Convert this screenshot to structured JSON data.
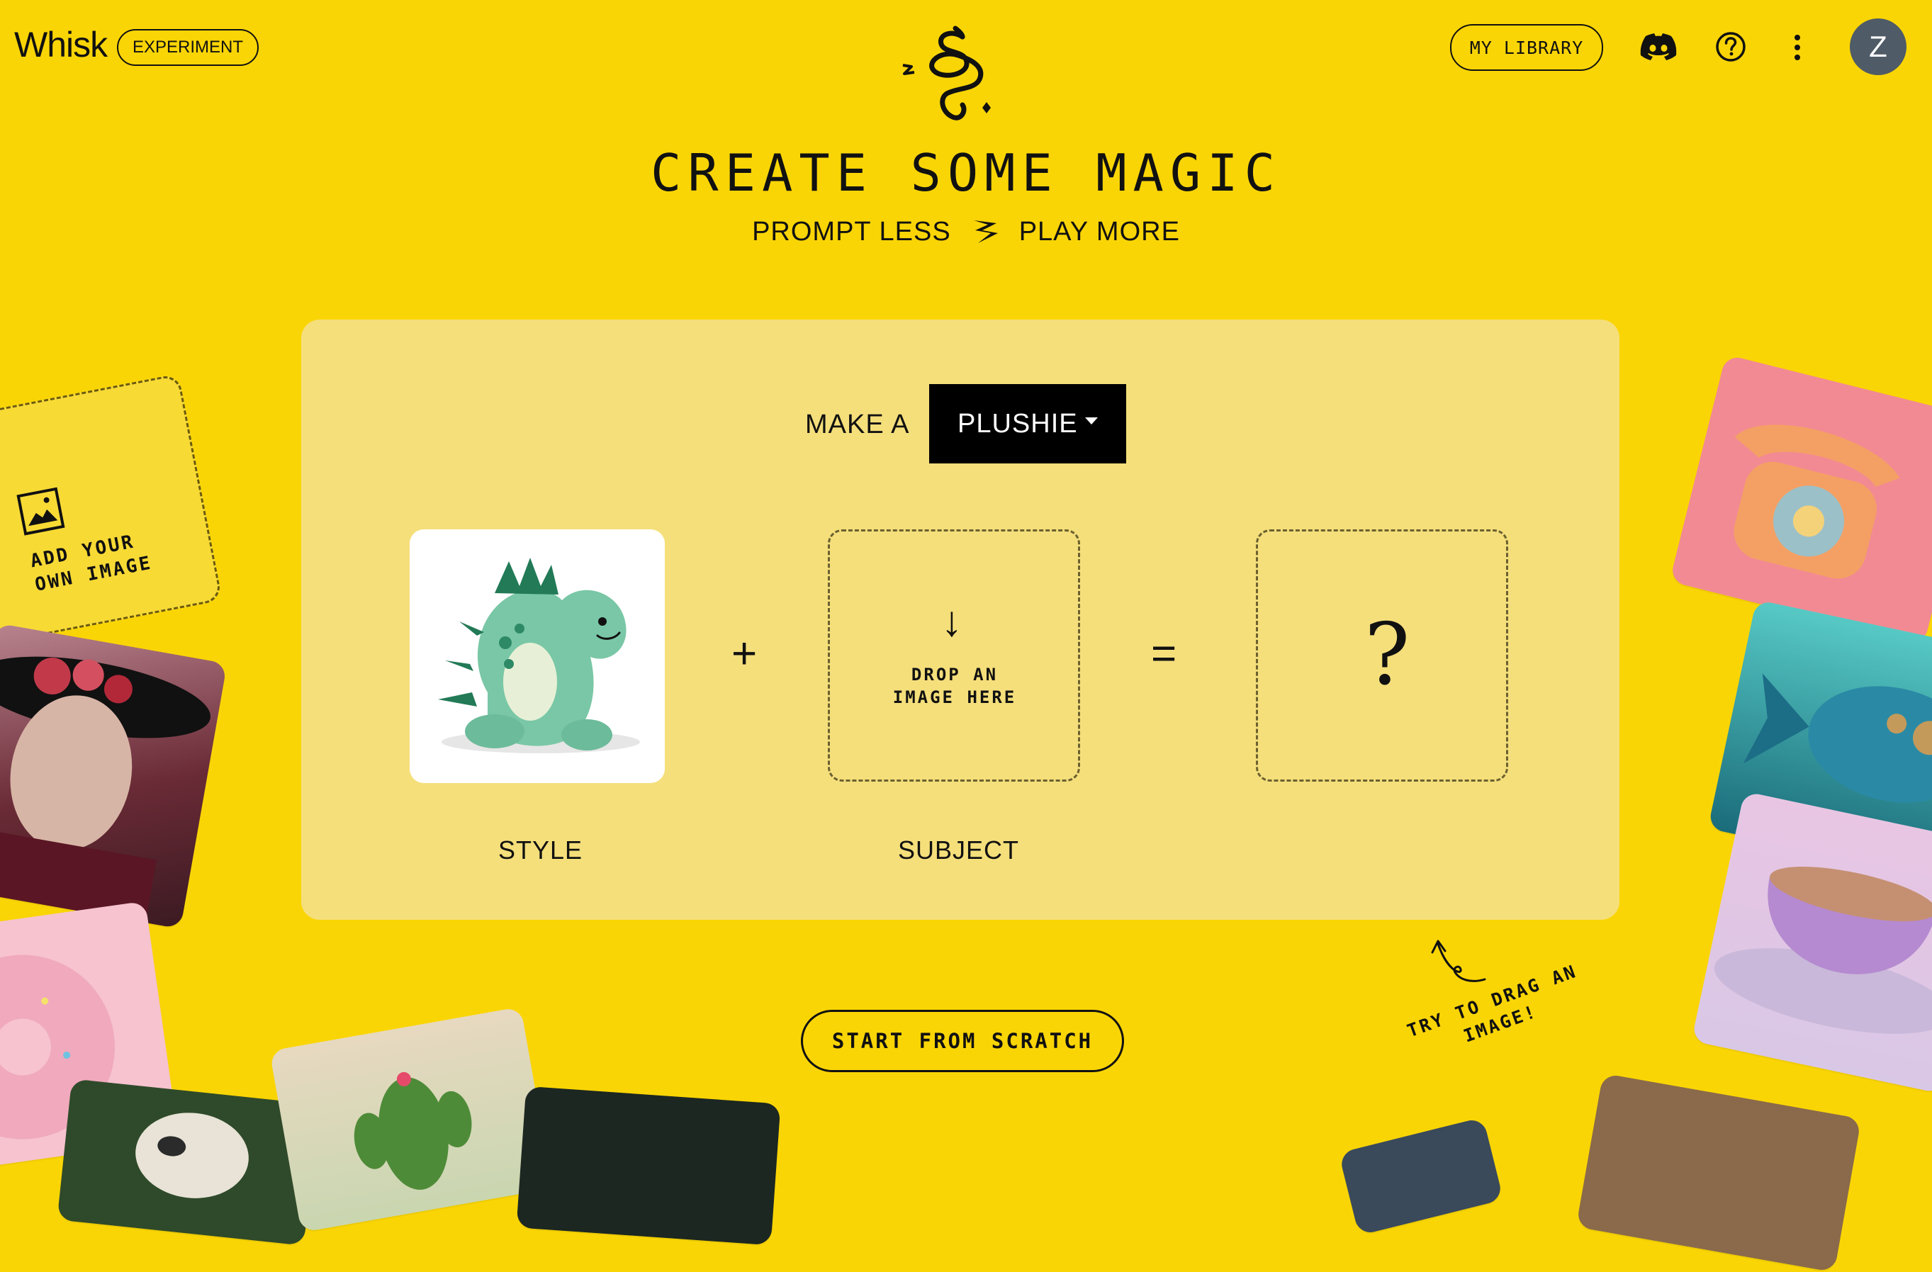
{
  "header": {
    "brand": "Whisk",
    "badge": "EXPERIMENT",
    "library_label": "MY LIBRARY",
    "avatar_initial": "Z"
  },
  "hero": {
    "title": "CREATE SOME MAGIC",
    "tagline_left": "PROMPT LESS",
    "tagline_right": "PLAY MORE"
  },
  "panel": {
    "make_label": "MAKE A",
    "style_select": {
      "selected": "PLUSHIE"
    },
    "plus": "+",
    "equals": "=",
    "drop_arrow": "↓",
    "drop_text_1": "DROP AN",
    "drop_text_2": "IMAGE HERE",
    "result_placeholder": "?",
    "style_caption": "STYLE",
    "subject_caption": "SUBJECT"
  },
  "actions": {
    "scratch_label": "START FROM SCRATCH"
  },
  "side": {
    "add_own_1": "ADD YOUR",
    "add_own_2": "OWN IMAGE",
    "drag_hint_1": "TRY TO DRAG AN",
    "drag_hint_2": "IMAGE!"
  },
  "colors": {
    "background": "#FAD505",
    "panel": "#F5DF7B",
    "ink": "#111111",
    "avatar": "#4F5B66"
  }
}
